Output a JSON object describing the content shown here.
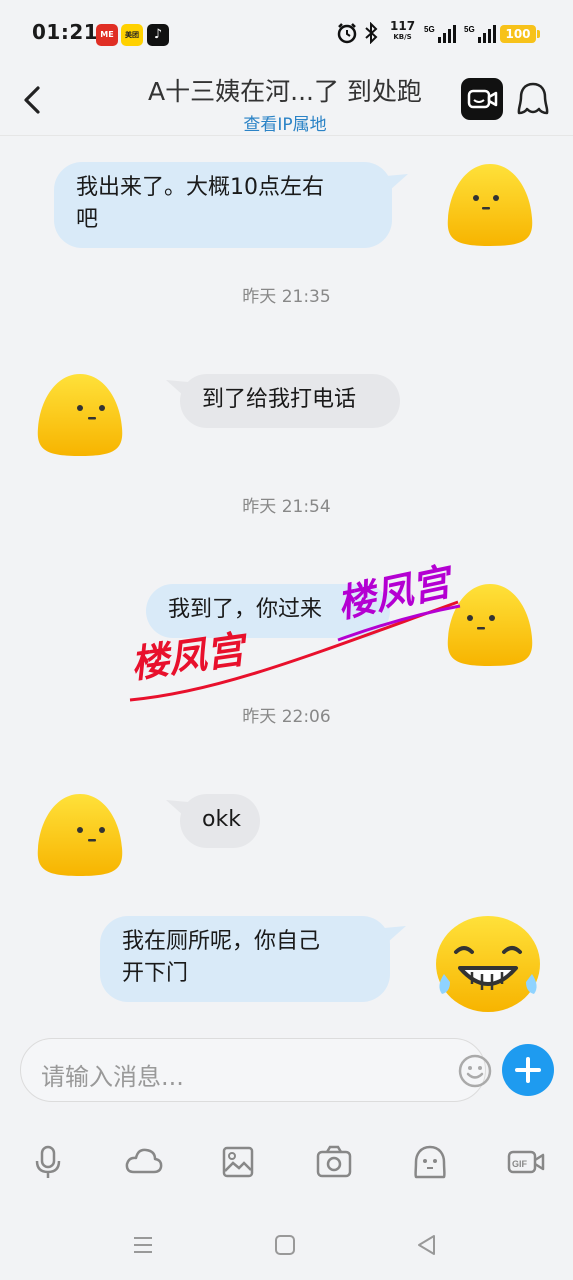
{
  "status_bar": {
    "time": "01:21",
    "apps": [
      "ME",
      "美团",
      "♪"
    ],
    "net_speed": "117",
    "net_unit": "KB/S",
    "sig1_label": "5G",
    "sig2_label": "5G",
    "battery": "100"
  },
  "header": {
    "title": "A十三姨在河...了 到处跑",
    "subtitle": "查看IP属地"
  },
  "messages": [
    {
      "from": "me",
      "text_line1": "我出来了。大概10点左右",
      "text_line2": "吧"
    },
    {
      "timestamp": "昨天 21:35"
    },
    {
      "from": "other",
      "text": "到了给我打电话"
    },
    {
      "timestamp": "昨天 21:54"
    },
    {
      "from": "me",
      "text": "我到了，你过来"
    },
    {
      "timestamp": "昨天 22:06"
    },
    {
      "from": "other",
      "text": "okk"
    },
    {
      "from": "me",
      "text_line1": "我在厕所呢，你自己",
      "text_line2": "开下门"
    }
  ],
  "watermark": {
    "text": "楼凤宫"
  },
  "input": {
    "placeholder": "请输入消息..."
  },
  "toolbar": {
    "items": [
      "mic-icon",
      "cloud-icon",
      "image-icon",
      "camera-icon",
      "sticker-icon",
      "gif-icon"
    ]
  },
  "colors": {
    "accent": "#1e9bf0",
    "my_bubble": "#d9eaf8",
    "other_bubble": "#e6e7ea",
    "link": "#2b83c6"
  }
}
